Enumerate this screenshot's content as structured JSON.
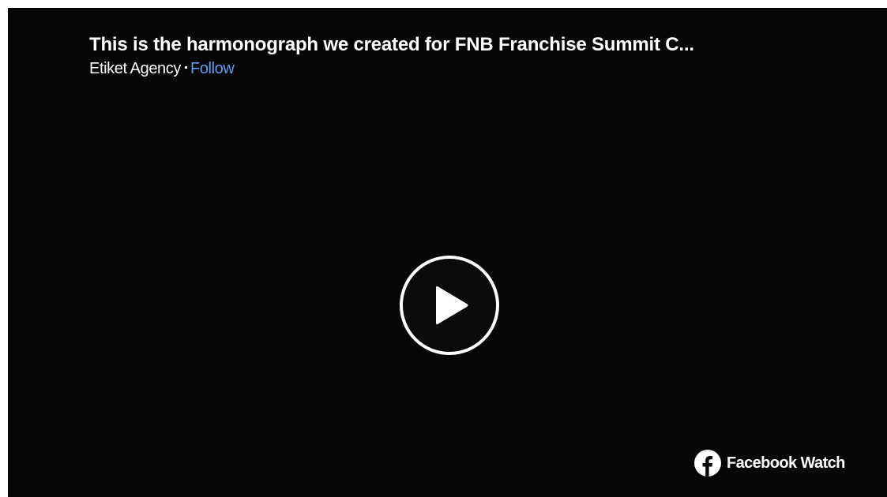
{
  "video": {
    "title": "This is the harmonograph we created for FNB Franchise Summit C...",
    "author": "Etiket Agency",
    "follow_label": "Follow",
    "play_icon": "play-icon"
  },
  "branding": {
    "label": "Facebook Watch",
    "icon": "facebook-icon"
  },
  "colors": {
    "background": "#060606",
    "follow_link": "#5b9cf5",
    "text": "#ffffff"
  }
}
